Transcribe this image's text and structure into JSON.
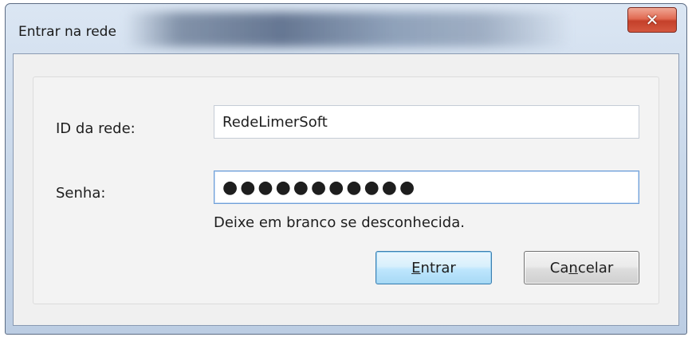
{
  "window": {
    "title": "Entrar na rede",
    "close_symbol": "✕"
  },
  "form": {
    "network_id_label": "ID da rede:",
    "network_id_value": "RedeLimerSoft",
    "password_label": "Senha:",
    "password_mask": "●●●●●●●●●●●",
    "password_hint": "Deixe em branco se desconhecida."
  },
  "buttons": {
    "enter_before": "",
    "enter_mnemonic": "E",
    "enter_after": "ntrar",
    "cancel_before": "Ca",
    "cancel_mnemonic": "n",
    "cancel_after": "celar"
  },
  "icons": {
    "close": "close-icon"
  },
  "colors": {
    "primary_button_border": "#3c7fb1",
    "close_button": "#c4402a",
    "focus_border": "#6f9fd8"
  }
}
